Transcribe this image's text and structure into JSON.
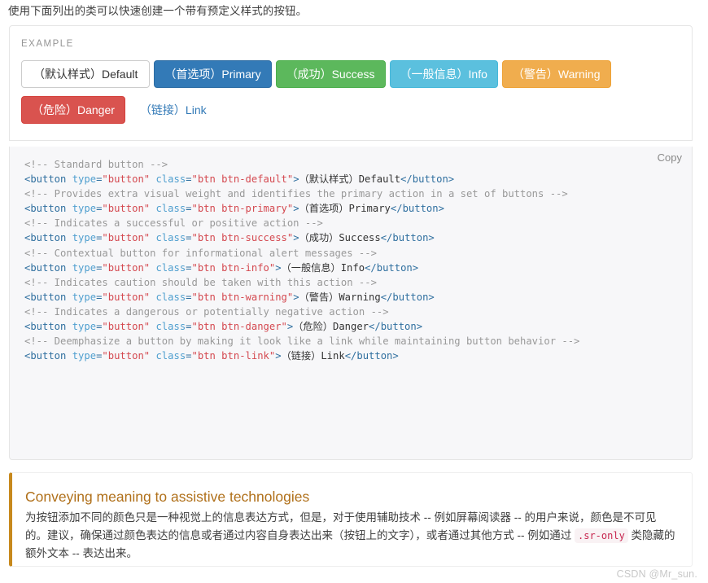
{
  "intro": {
    "text": "使用下面列出的类可以快速创建一个带有预定义样式的按钮。"
  },
  "example": {
    "label": "EXAMPLE",
    "buttons": [
      {
        "name": "default",
        "label": "（默认样式）Default",
        "color": "#ffffff",
        "border": "#cccccc",
        "text_color": "#333333"
      },
      {
        "name": "primary",
        "label": "（首选项）Primary",
        "color": "#337ab7",
        "border": "#2e6da4",
        "text_color": "#ffffff"
      },
      {
        "name": "success",
        "label": "（成功）Success",
        "color": "#5cb85c",
        "border": "#4cae4c",
        "text_color": "#ffffff"
      },
      {
        "name": "info",
        "label": "（一般信息）Info",
        "color": "#5bc0de",
        "border": "#46b8da",
        "text_color": "#ffffff"
      },
      {
        "name": "warning",
        "label": "（警告）Warning",
        "color": "#f0ad4e",
        "border": "#eea236",
        "text_color": "#ffffff"
      },
      {
        "name": "danger",
        "label": "（危险）Danger",
        "color": "#d9534f",
        "border": "#d43f3a",
        "text_color": "#ffffff"
      },
      {
        "name": "link",
        "label": "（链接）Link",
        "color": "transparent",
        "border": "transparent",
        "text_color": "#337ab7"
      }
    ]
  },
  "code": {
    "copy_label": "Copy",
    "lines": [
      {
        "comment": "<!-- Standard button -->"
      },
      {
        "tag_open": "<button",
        "attr1": "type",
        "val1": "\"button\"",
        "attr2": "class",
        "val2": "\"btn btn-default\"",
        "gt": ">",
        "content": "（默认样式）Default",
        "tag_close": "</button>"
      },
      {
        "comment": "<!-- Provides extra visual weight and identifies the primary action in a set of buttons -->"
      },
      {
        "tag_open": "<button",
        "attr1": "type",
        "val1": "\"button\"",
        "attr2": "class",
        "val2": "\"btn btn-primary\"",
        "gt": ">",
        "content": "（首选项）Primary",
        "tag_close": "</button>"
      },
      {
        "comment": "<!-- Indicates a successful or positive action -->"
      },
      {
        "tag_open": "<button",
        "attr1": "type",
        "val1": "\"button\"",
        "attr2": "class",
        "val2": "\"btn btn-success\"",
        "gt": ">",
        "content": "（成功）Success",
        "tag_close": "</button>"
      },
      {
        "comment": "<!-- Contextual button for informational alert messages -->"
      },
      {
        "tag_open": "<button",
        "attr1": "type",
        "val1": "\"button\"",
        "attr2": "class",
        "val2": "\"btn btn-info\"",
        "gt": ">",
        "content": "（一般信息）Info",
        "tag_close": "</button>"
      },
      {
        "comment": "<!-- Indicates caution should be taken with this action -->"
      },
      {
        "tag_open": "<button",
        "attr1": "type",
        "val1": "\"button\"",
        "attr2": "class",
        "val2": "\"btn btn-warning\"",
        "gt": ">",
        "content": "（警告）Warning",
        "tag_close": "</button>"
      },
      {
        "comment": "<!-- Indicates a dangerous or potentially negative action -->"
      },
      {
        "tag_open": "<button",
        "attr1": "type",
        "val1": "\"button\"",
        "attr2": "class",
        "val2": "\"btn btn-danger\"",
        "gt": ">",
        "content": "（危险）Danger",
        "tag_close": "</button>"
      },
      {
        "comment": "<!-- Deemphasize a button by making it look like a link while maintaining button behavior -->"
      },
      {
        "tag_open": "<button",
        "attr1": "type",
        "val1": "\"button\"",
        "attr2": "class",
        "val2": "\"btn btn-link\"",
        "gt": ">",
        "content": "（链接）Link",
        "tag_close": "</button>"
      }
    ]
  },
  "callout": {
    "accent_color": "#c7891d",
    "title": "Conveying meaning to assistive technologies",
    "body_part1": "为按钮添加不同的颜色只是一种视觉上的信息表达方式，但是，对于使用辅助技术 -- 例如屏幕阅读器 -- 的用户来说，颜色是不可见的。建议，确保通过颜色表达的信息或者通过内容自身表达出来（按钮上的文字），或者通过其他方式 -- 例如通过 ",
    "code_snippet": ".sr-only",
    "body_part2": " 类隐藏的额外文本 -- 表达出来。"
  },
  "watermark": {
    "text": "CSDN @Mr_sun."
  }
}
